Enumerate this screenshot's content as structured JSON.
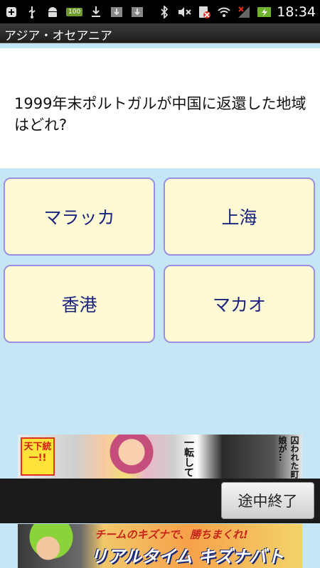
{
  "status_bar": {
    "time": "18:34",
    "battery_badge": "100",
    "icons": [
      "add-icon",
      "usb-icon",
      "android-icon",
      "battery-badge-icon",
      "download-icon",
      "download-icon",
      "download-icon",
      "bluetooth-icon",
      "mute-icon",
      "no-sim-icon",
      "wifi-icon",
      "no-signal-icon",
      "battery-icon"
    ]
  },
  "titlebar": {
    "title": "アジア・オセアニア"
  },
  "question": {
    "text": "1999年末ポルトガルが中国に返還した地域はどれ?"
  },
  "answers": [
    {
      "label": "マラッカ"
    },
    {
      "label": "上海"
    },
    {
      "label": "香港"
    },
    {
      "label": "マカオ"
    }
  ],
  "action": {
    "end_label": "途中終了"
  },
  "ads": {
    "ad1": {
      "badge": "天下統一!!",
      "text1": "一転して",
      "text2": "囚われた町娘が…"
    },
    "ad2": {
      "line1": "チームのキズナで、勝ちまくれ!",
      "line2": "リアルタイム キズナバトル!"
    }
  },
  "colors": {
    "background": "#c5e6f5",
    "answer_fill": "#fffad6",
    "answer_border": "#9a8ee0",
    "answer_text": "#1a237e"
  }
}
